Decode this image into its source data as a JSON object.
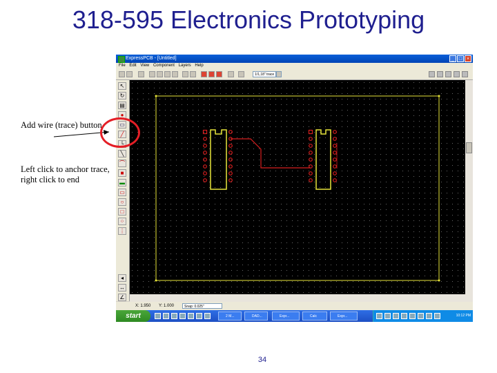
{
  "slide": {
    "title": "318-595 Electronics Prototyping",
    "note1": "Add wire (trace) button",
    "note2": "Left click to anchor trace, right click to end",
    "page_number": "34"
  },
  "app": {
    "window_title": "ExpressPCB - [Untitled]",
    "menu": [
      "File",
      "Edit",
      "View",
      "Component",
      "Layers",
      "Help"
    ],
    "layer_select": "1/1,18\" trace",
    "status": {
      "x": "X: 1.950",
      "y": "Y: 1.000",
      "snap": "Snap: 0.025\""
    },
    "taskbar": {
      "start": "start",
      "tasks": [
        "2 M...",
        "DAD...",
        "Expr...",
        "Calc",
        "Expr..."
      ],
      "clock": "10:12 PM"
    }
  },
  "colors": {
    "title_blue": "#1f1f8f",
    "pcb_background": "#000000",
    "silkscreen": "#e8e63a",
    "pad_red": "#d81f1f",
    "trace_red": "#d81f1f",
    "highlight": "#e41e26"
  }
}
